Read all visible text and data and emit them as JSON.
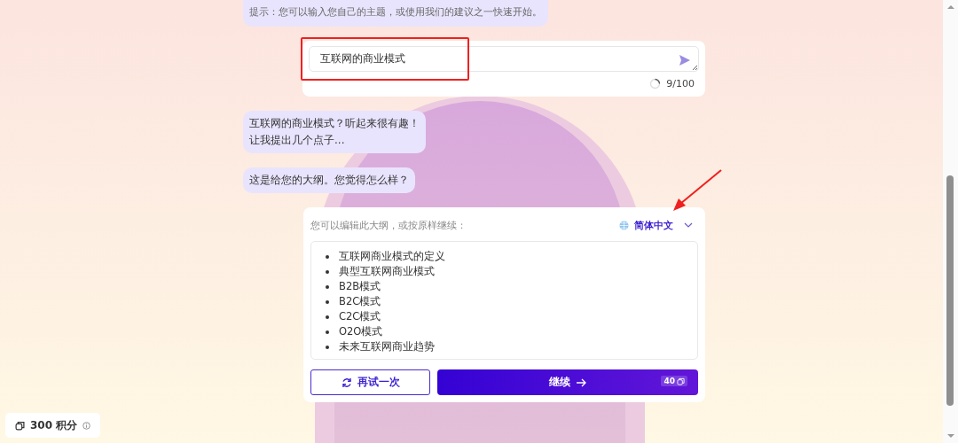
{
  "hint_bubble": {
    "text": "提示：您可以输入您自己的主题，或使用我们的建议之一快速开始。"
  },
  "topic_input": {
    "value": "互联网的商业模式",
    "counter": "9/100"
  },
  "messages": [
    {
      "lines": [
        "互联网的商业模式？听起来很有趣！",
        "让我提出几个点子..."
      ]
    },
    {
      "lines": [
        "这是给您的大纲。您觉得怎么样？"
      ]
    }
  ],
  "outline_card": {
    "prompt": "您可以编辑此大纲，或按原样继续：",
    "language": "简体中文",
    "items": [
      "互联网商业模式的定义",
      "典型互联网商业模式",
      "B2B模式",
      "B2C模式",
      "C2C模式",
      "O2O模式",
      "未来互联网商业趋势"
    ],
    "retry_button": "再试一次",
    "continue_button": "继续",
    "cost": "40"
  },
  "credits": {
    "text": "300 积分"
  }
}
